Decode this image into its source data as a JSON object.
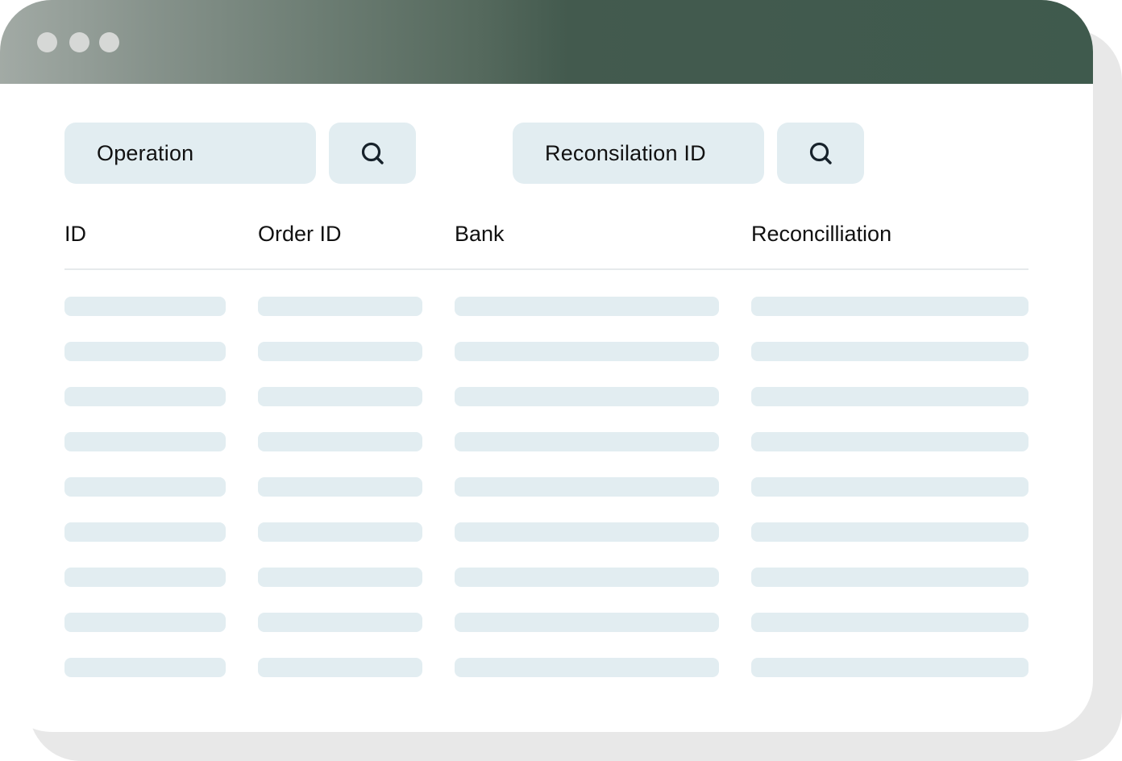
{
  "window": {
    "accent_color": "#3f5a4d",
    "controls": [
      "dot",
      "dot",
      "dot"
    ]
  },
  "filters": {
    "operation_field": "Operation",
    "operation_search_icon": "search-icon",
    "reconciliation_field": "Reconsilation ID",
    "reconciliation_search_icon": "search-icon"
  },
  "table": {
    "columns": [
      "ID",
      "Order ID",
      "Bank",
      "Reconcilliation"
    ],
    "placeholder_row_count": 9
  }
}
